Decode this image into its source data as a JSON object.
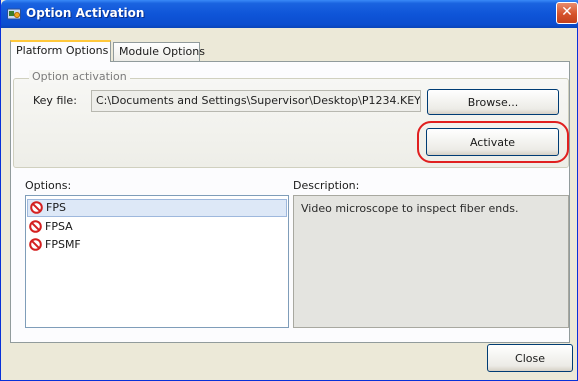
{
  "window": {
    "title": "Option Activation",
    "close_glyph": "✕"
  },
  "tabs": [
    {
      "label": "Platform Options",
      "active": true
    },
    {
      "label": "Module Options",
      "active": false
    }
  ],
  "activation": {
    "group_label": "Option activation",
    "key_file_label": "Key file:",
    "key_file_value": "C:\\Documents and Settings\\Supervisor\\Desktop\\P1234.KEY",
    "browse_label": "Browse...",
    "activate_label": "Activate"
  },
  "options": {
    "label": "Options:",
    "items": [
      {
        "name": "FPS",
        "icon": "not-activated-icon",
        "selected": true
      },
      {
        "name": "FPSA",
        "icon": "not-activated-icon",
        "selected": false
      },
      {
        "name": "FPSMF",
        "icon": "not-activated-icon",
        "selected": false
      }
    ]
  },
  "description": {
    "label": "Description:",
    "text": "Video microscope to inspect fiber ends."
  },
  "footer": {
    "close_label": "Close"
  },
  "colors": {
    "titlebar": "#0f55d8",
    "highlight": "#e02020",
    "tab_accent": "#ffc83c"
  }
}
